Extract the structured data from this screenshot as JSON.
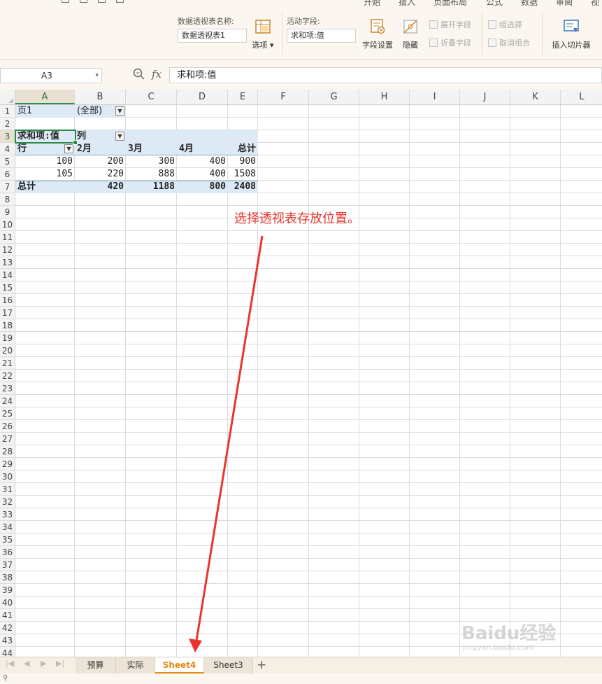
{
  "ribbon": {
    "menu_partial": [
      "开始",
      "插入",
      "页面布局",
      "公式",
      "数据",
      "审阅",
      "视"
    ],
    "pivot_name_label": "数据透视表名称:",
    "pivot_name_value": "数据透视表1",
    "options_label": "选项",
    "active_field_label": "活动字段:",
    "active_field_value": "求和项:值",
    "field_settings_label": "字段设置",
    "hide_label": "隐藏",
    "expand_field_label": "展开字段",
    "collapse_field_label": "折叠字段",
    "group_selection_label": "组选择",
    "ungroup_label": "取消组合",
    "insert_slicer_label": "插入切片器"
  },
  "formula_bar": {
    "name_box": "A3",
    "fx_label": "fx",
    "formula": "求和项:值"
  },
  "columns": [
    "A",
    "B",
    "C",
    "D",
    "E",
    "F",
    "G",
    "H",
    "I",
    "J",
    "K",
    "L"
  ],
  "rows": [
    "1",
    "2",
    "3",
    "4",
    "5",
    "6",
    "7",
    "8",
    "9",
    "10",
    "11",
    "12",
    "13",
    "14",
    "15",
    "16",
    "17",
    "18",
    "19",
    "20",
    "21",
    "22",
    "23",
    "24",
    "25",
    "26",
    "27",
    "28",
    "29",
    "30",
    "31",
    "32",
    "33",
    "34",
    "35",
    "36",
    "37",
    "38",
    "39",
    "40",
    "41",
    "42",
    "43",
    "44"
  ],
  "selected_cell": "A3",
  "pivot": {
    "page_field": "页1",
    "page_value": "(全部)",
    "data_field": "求和项:值",
    "col_field": "列",
    "row_field": "行",
    "col_headers": [
      "2月",
      "3月",
      "4月",
      "总计"
    ],
    "rows": [
      {
        "label": "100",
        "values": [
          "200",
          "300",
          "400",
          "900"
        ]
      },
      {
        "label": "105",
        "values": [
          "220",
          "888",
          "400",
          "1508"
        ]
      }
    ],
    "total_label": "总计",
    "totals": [
      "420",
      "1188",
      "800",
      "2408"
    ]
  },
  "annotation_text": "选择透视表存放位置。",
  "colors": {
    "annotation": "#e8362e",
    "active_tab": "#e28a14",
    "selection": "#2a8a46",
    "pivot_band": "#dde9f5"
  },
  "sheet_tabs": [
    {
      "label": "预算",
      "active": false
    },
    {
      "label": "实际",
      "active": false
    },
    {
      "label": "Sheet4",
      "active": true
    },
    {
      "label": "Sheet3",
      "active": false
    }
  ],
  "add_sheet_label": "+",
  "watermark": {
    "brand": "Baidu经验",
    "url": "jingyan.baidu.com"
  }
}
